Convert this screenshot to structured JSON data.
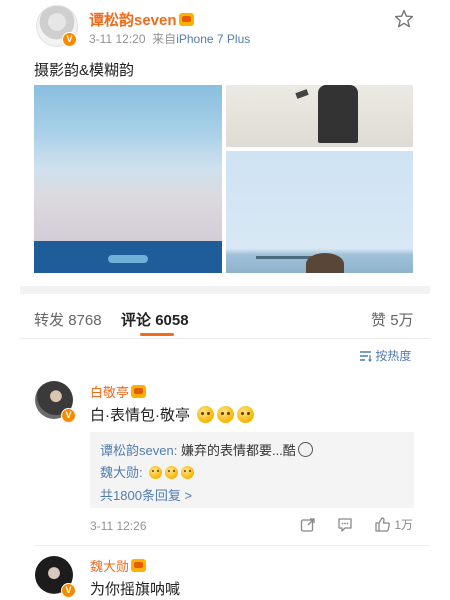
{
  "post": {
    "author": "谭松韵seven",
    "timestamp": "3-11 12:20",
    "source_prefix": "来自",
    "source_device": "iPhone 7 Plus",
    "text": "摄影韵&模糊韵",
    "verified_mark": "V"
  },
  "tabs": {
    "repost_label": "转发",
    "repost_count": "8768",
    "comment_label": "评论",
    "comment_count": "6058",
    "like_label": "赞",
    "like_count": "5万"
  },
  "sort": {
    "label": "按热度"
  },
  "comments": [
    {
      "author": "白敬亭",
      "text": "白·表情包·敬亭",
      "timestamp": "3-11 12:26",
      "like_count": "1万",
      "replies": [
        {
          "author": "谭松韵seven",
          "sep": ":",
          "text": "嫌弃的表情都要...酷"
        },
        {
          "author": "魏大勋",
          "sep": ":",
          "text": ""
        }
      ],
      "more_replies": "共1800条回复 >"
    },
    {
      "author": "魏大勋",
      "text": "为你摇旗呐喊"
    }
  ],
  "colors": {
    "accent": "#f26a1b",
    "link": "#507daf",
    "gray": "#939393"
  }
}
